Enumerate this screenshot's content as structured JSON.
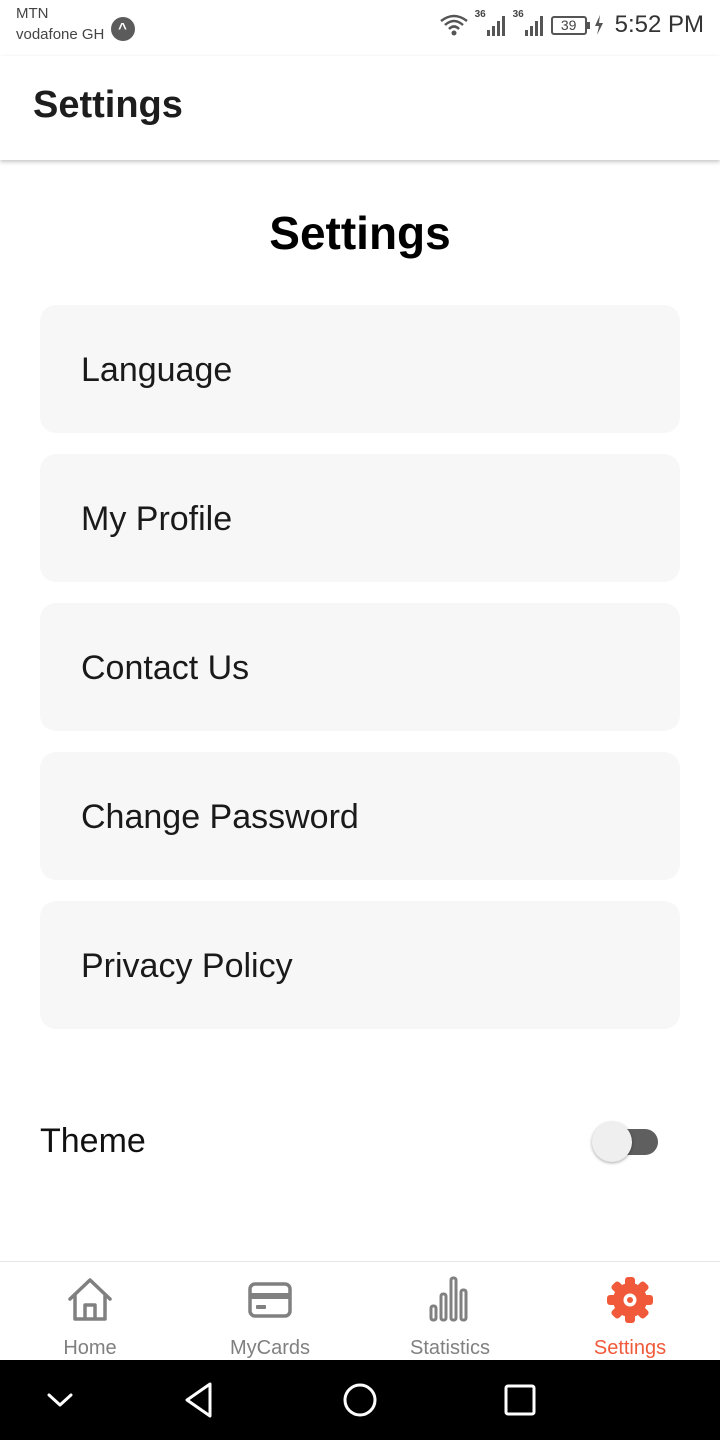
{
  "status_bar": {
    "carrier_1": "MTN",
    "carrier_2": "vodafone GH",
    "carrier_badge": "^",
    "network_1": "36",
    "network_2": "36",
    "battery_level": "39",
    "time": "5:52 PM",
    "icons": [
      "wifi-icon",
      "signal-icon",
      "signal-icon",
      "battery-icon",
      "charging-icon"
    ]
  },
  "app_bar": {
    "title": "Settings"
  },
  "page": {
    "heading": "Settings",
    "items": [
      {
        "label": "Language"
      },
      {
        "label": "My Profile"
      },
      {
        "label": "Contact Us"
      },
      {
        "label": "Change Password"
      },
      {
        "label": "Privacy Policy"
      }
    ],
    "theme": {
      "label": "Theme",
      "enabled": false
    }
  },
  "bottom_nav": {
    "items": [
      {
        "label": "Home",
        "icon": "home-icon",
        "active": false
      },
      {
        "label": "MyCards",
        "icon": "card-icon",
        "active": false
      },
      {
        "label": "Statistics",
        "icon": "bar-chart-icon",
        "active": false
      },
      {
        "label": "Settings",
        "icon": "gear-icon",
        "active": true
      }
    ]
  },
  "system_nav": {
    "icons": [
      "chevron-down-icon",
      "back-icon",
      "home-circle-icon",
      "recents-icon"
    ]
  },
  "colors": {
    "accent": "#f05a3a",
    "inactive": "#808080",
    "card_background": "#f7f7f7",
    "toggle_track": "#5f5f5f"
  }
}
